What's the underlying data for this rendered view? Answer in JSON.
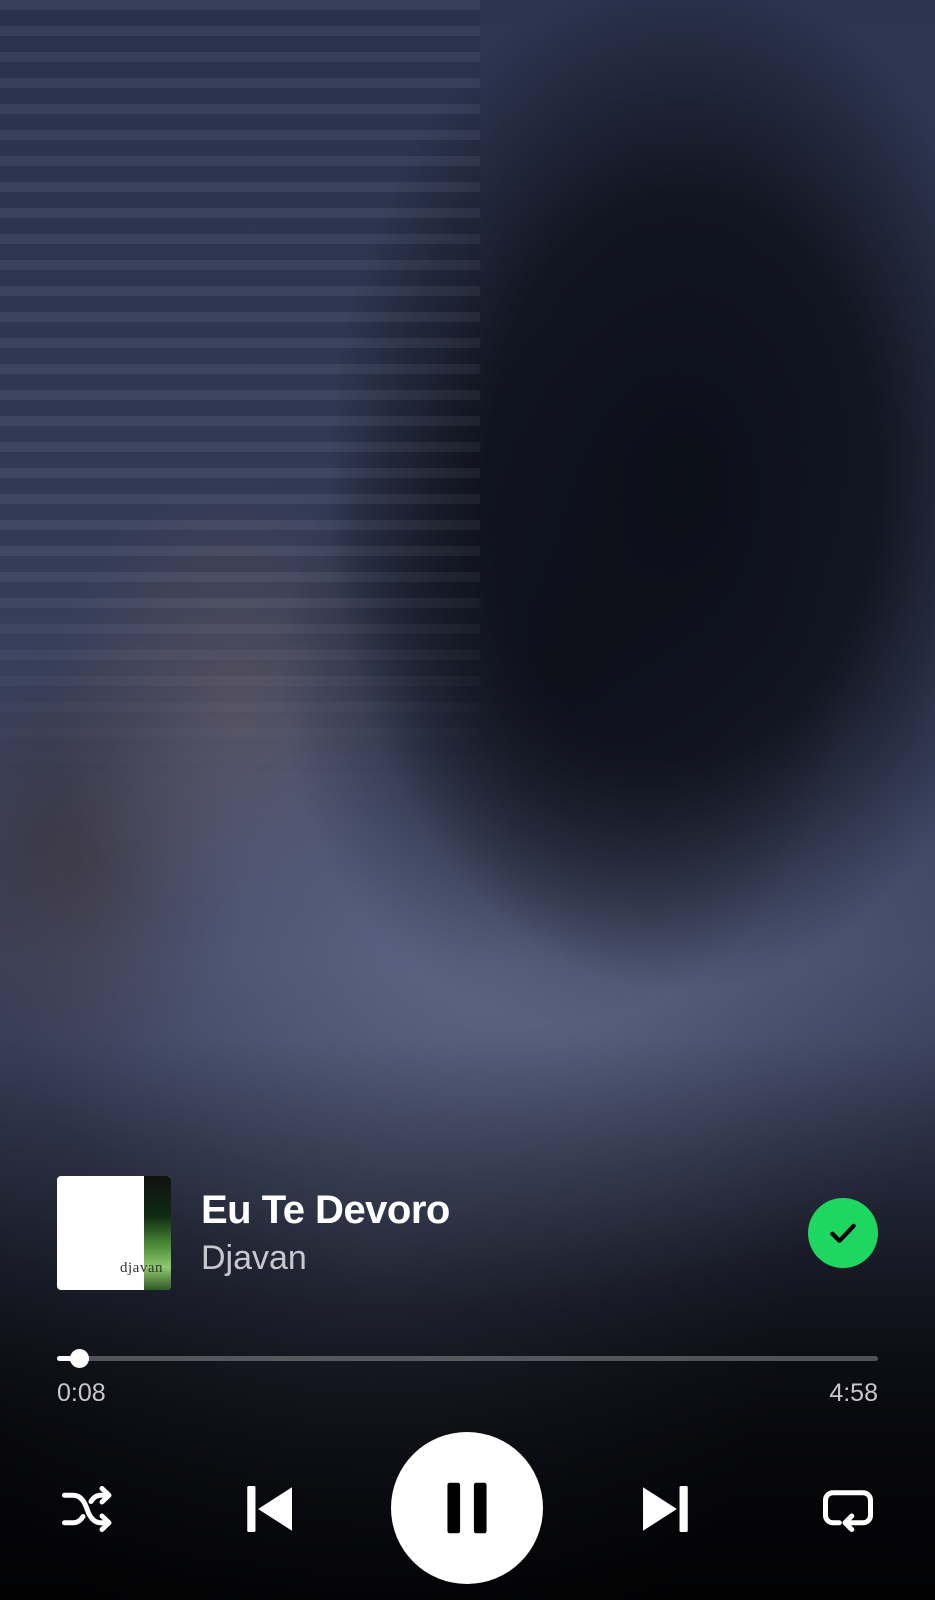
{
  "track": {
    "title": "Eu Te Devoro",
    "artist": "Djavan",
    "cover_text": "djavan",
    "liked": true
  },
  "playback": {
    "elapsed": "0:08",
    "duration": "4:58",
    "progress_fraction": 0.027,
    "is_playing": true
  },
  "controls": {
    "shuffle_icon": "shuffle-icon",
    "previous_icon": "skip-previous-icon",
    "pause_icon": "pause-icon",
    "next_icon": "skip-next-icon",
    "repeat_icon": "repeat-icon"
  },
  "colors": {
    "accent_green": "#1ed760",
    "text_primary": "#ffffff",
    "text_secondary": "#c8c8cc"
  }
}
